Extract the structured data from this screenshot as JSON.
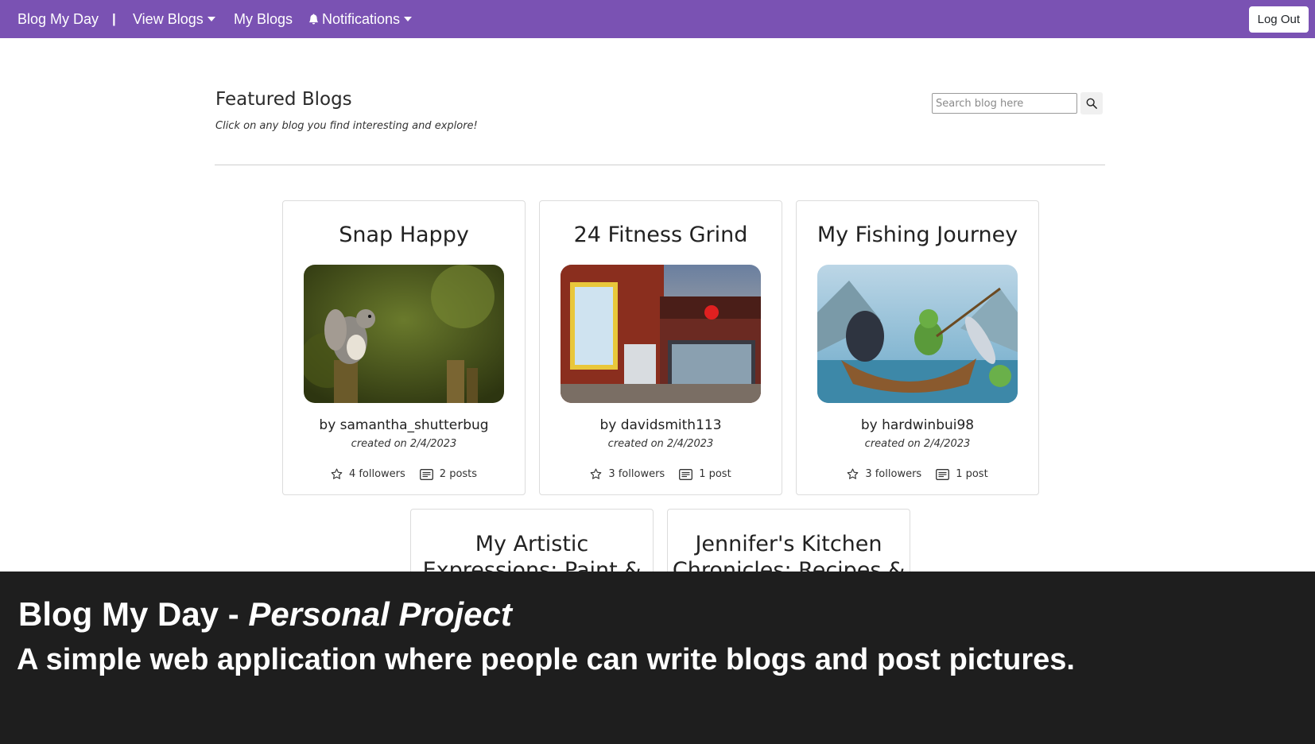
{
  "navbar": {
    "brand": "Blog My Day",
    "separator": "|",
    "view_blogs": "View Blogs",
    "my_blogs": "My Blogs",
    "notifications": "Notifications",
    "logout": "Log Out",
    "color": "#7a52b3"
  },
  "header": {
    "title": "Featured Blogs",
    "subtitle": "Click on any blog you find interesting and explore!",
    "search_placeholder": "Search blog here"
  },
  "cards": [
    {
      "title": "Snap Happy",
      "author": "by samantha_shutterbug",
      "date": "created on 2/4/2023",
      "followers": "4 followers",
      "posts": "2 posts",
      "image": "squirrel-photo"
    },
    {
      "title": "24 Fitness Grind",
      "author": "by davidsmith113",
      "date": "created on 2/4/2023",
      "followers": "3 followers",
      "posts": "1 post",
      "image": "gym-building-photo"
    },
    {
      "title": "My Fishing Journey",
      "author": "by hardwinbui98",
      "date": "created on 2/4/2023",
      "followers": "3 followers",
      "posts": "1 post",
      "image": "fishing-illustration"
    },
    {
      "title": "My Artistic Expressions: Paint & Mixed Media"
    },
    {
      "title": "Jennifer's Kitchen Chronicles: Recipes &"
    }
  ],
  "caption": {
    "title_main": "Blog My Day - ",
    "title_em": "Personal Project",
    "description": "A simple web application where people can write blogs and post pictures."
  }
}
